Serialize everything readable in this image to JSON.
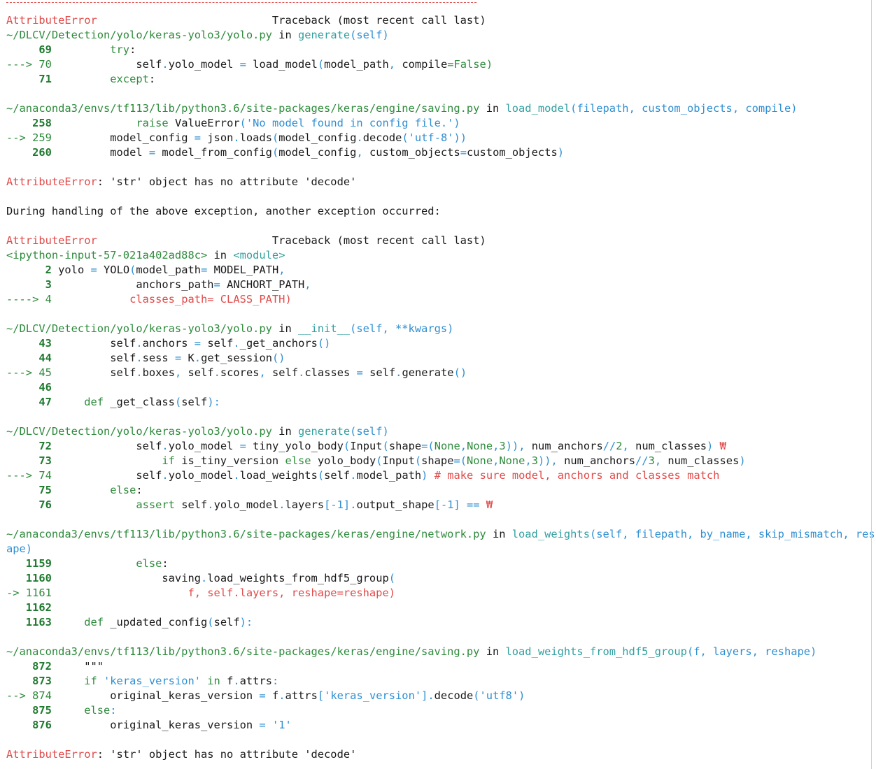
{
  "colors": {
    "red": "#e24a4a",
    "green": "#2e8b3c",
    "lineno_green": "#1e7a2e",
    "blue": "#2f8fd1",
    "teal": "#33a0a0",
    "text": "#1a1a1a",
    "background": "#ffffff"
  },
  "lines": [
    [],
    [
      {
        "t": "AttributeError",
        "c": "r"
      },
      {
        "t": "                           Traceback (most recent call last)",
        "c": "k"
      }
    ],
    [
      {
        "t": "~/DLCV/Detection/yolo/keras-yolo3/yolo.py",
        "c": "g"
      },
      {
        "t": " in ",
        "c": "k"
      },
      {
        "t": "generate",
        "c": "c"
      },
      {
        "t": "(self)",
        "c": "b"
      }
    ],
    [
      {
        "t": "     69",
        "c": "gb"
      },
      {
        "t": "         try",
        "c": "g"
      },
      {
        "t": ":",
        "c": "k"
      }
    ],
    [
      {
        "t": "---> 70",
        "c": "g"
      },
      {
        "t": "             self",
        "c": "k"
      },
      {
        "t": ".",
        "c": "b"
      },
      {
        "t": "yolo_model ",
        "c": "k"
      },
      {
        "t": "=",
        "c": "b"
      },
      {
        "t": " load_model",
        "c": "k"
      },
      {
        "t": "(",
        "c": "b"
      },
      {
        "t": "model_path",
        "c": "k"
      },
      {
        "t": ",",
        "c": "b"
      },
      {
        "t": " compile",
        "c": "k"
      },
      {
        "t": "=False)",
        "c": "g"
      }
    ],
    [
      {
        "t": "     71",
        "c": "gb"
      },
      {
        "t": "         except",
        "c": "g"
      },
      {
        "t": ":",
        "c": "k"
      }
    ],
    [],
    [
      {
        "t": "~/anaconda3/envs/tf113/lib/python3.6/site-packages/keras/engine/saving.py",
        "c": "g"
      },
      {
        "t": " in ",
        "c": "k"
      },
      {
        "t": "load_model",
        "c": "c"
      },
      {
        "t": "(filepath, custom_objects, compile)",
        "c": "b"
      }
    ],
    [
      {
        "t": "    258",
        "c": "gb"
      },
      {
        "t": "             raise",
        "c": "g"
      },
      {
        "t": " ValueError",
        "c": "k"
      },
      {
        "t": "('No model found in config file.')",
        "c": "b"
      }
    ],
    [
      {
        "t": "--> 259",
        "c": "g"
      },
      {
        "t": "         model_config ",
        "c": "k"
      },
      {
        "t": "=",
        "c": "b"
      },
      {
        "t": " json",
        "c": "k"
      },
      {
        "t": ".",
        "c": "b"
      },
      {
        "t": "loads",
        "c": "k"
      },
      {
        "t": "(",
        "c": "b"
      },
      {
        "t": "model_config",
        "c": "k"
      },
      {
        "t": ".",
        "c": "b"
      },
      {
        "t": "decode",
        "c": "k"
      },
      {
        "t": "('utf-8'))",
        "c": "b"
      }
    ],
    [
      {
        "t": "    260",
        "c": "gb"
      },
      {
        "t": "         model ",
        "c": "k"
      },
      {
        "t": "=",
        "c": "b"
      },
      {
        "t": " model_from_config",
        "c": "k"
      },
      {
        "t": "(",
        "c": "b"
      },
      {
        "t": "model_config",
        "c": "k"
      },
      {
        "t": ",",
        "c": "b"
      },
      {
        "t": " custom_objects",
        "c": "k"
      },
      {
        "t": "=",
        "c": "b"
      },
      {
        "t": "custom_objects",
        "c": "k"
      },
      {
        "t": ")",
        "c": "b"
      }
    ],
    [],
    [
      {
        "t": "AttributeError",
        "c": "r"
      },
      {
        "t": ": 'str' object has no attribute 'decode'",
        "c": "k"
      }
    ],
    [],
    [
      {
        "t": "During handling of the above exception, another exception occurred:",
        "c": "k"
      }
    ],
    [],
    [
      {
        "t": "AttributeError",
        "c": "r"
      },
      {
        "t": "                           Traceback (most recent call last)",
        "c": "k"
      }
    ],
    [
      {
        "t": "<ipython-input-57-021a402ad88c>",
        "c": "g"
      },
      {
        "t": " in ",
        "c": "k"
      },
      {
        "t": "<module>",
        "c": "c"
      }
    ],
    [
      {
        "t": "      2",
        "c": "gb"
      },
      {
        "t": " yolo ",
        "c": "k"
      },
      {
        "t": "=",
        "c": "b"
      },
      {
        "t": " YOLO",
        "c": "k"
      },
      {
        "t": "(",
        "c": "b"
      },
      {
        "t": "model_path",
        "c": "k"
      },
      {
        "t": "=",
        "c": "b"
      },
      {
        "t": " MODEL_PATH",
        "c": "k"
      },
      {
        "t": ",",
        "c": "b"
      }
    ],
    [
      {
        "t": "      3",
        "c": "gb"
      },
      {
        "t": "             anchors_path",
        "c": "k"
      },
      {
        "t": "=",
        "c": "b"
      },
      {
        "t": " ANCHORT_PATH",
        "c": "k"
      },
      {
        "t": ",",
        "c": "b"
      }
    ],
    [
      {
        "t": "----> 4",
        "c": "g"
      },
      {
        "t": "            classes_path= CLASS_PATH)",
        "c": "r"
      }
    ],
    [],
    [
      {
        "t": "~/DLCV/Detection/yolo/keras-yolo3/yolo.py",
        "c": "g"
      },
      {
        "t": " in ",
        "c": "k"
      },
      {
        "t": "__init__",
        "c": "c"
      },
      {
        "t": "(self, **kwargs)",
        "c": "b"
      }
    ],
    [
      {
        "t": "     43",
        "c": "gb"
      },
      {
        "t": "         self",
        "c": "k"
      },
      {
        "t": ".",
        "c": "b"
      },
      {
        "t": "anchors ",
        "c": "k"
      },
      {
        "t": "=",
        "c": "b"
      },
      {
        "t": " self",
        "c": "k"
      },
      {
        "t": ".",
        "c": "b"
      },
      {
        "t": "_get_anchors",
        "c": "k"
      },
      {
        "t": "()",
        "c": "b"
      }
    ],
    [
      {
        "t": "     44",
        "c": "gb"
      },
      {
        "t": "         self",
        "c": "k"
      },
      {
        "t": ".",
        "c": "b"
      },
      {
        "t": "sess ",
        "c": "k"
      },
      {
        "t": "=",
        "c": "b"
      },
      {
        "t": " K",
        "c": "k"
      },
      {
        "t": ".",
        "c": "b"
      },
      {
        "t": "get_session",
        "c": "k"
      },
      {
        "t": "()",
        "c": "b"
      }
    ],
    [
      {
        "t": "---> 45",
        "c": "g"
      },
      {
        "t": "         self",
        "c": "k"
      },
      {
        "t": ".",
        "c": "b"
      },
      {
        "t": "boxes",
        "c": "k"
      },
      {
        "t": ",",
        "c": "b"
      },
      {
        "t": " self",
        "c": "k"
      },
      {
        "t": ".",
        "c": "b"
      },
      {
        "t": "scores",
        "c": "k"
      },
      {
        "t": ",",
        "c": "b"
      },
      {
        "t": " self",
        "c": "k"
      },
      {
        "t": ".",
        "c": "b"
      },
      {
        "t": "classes ",
        "c": "k"
      },
      {
        "t": "=",
        "c": "b"
      },
      {
        "t": " self",
        "c": "k"
      },
      {
        "t": ".",
        "c": "b"
      },
      {
        "t": "generate",
        "c": "k"
      },
      {
        "t": "()",
        "c": "b"
      }
    ],
    [
      {
        "t": "     46",
        "c": "gb"
      }
    ],
    [
      {
        "t": "     47",
        "c": "gb"
      },
      {
        "t": "     def",
        "c": "g"
      },
      {
        "t": " _get_class",
        "c": "k"
      },
      {
        "t": "(",
        "c": "b"
      },
      {
        "t": "self",
        "c": "k"
      },
      {
        "t": "):",
        "c": "b"
      }
    ],
    [],
    [
      {
        "t": "~/DLCV/Detection/yolo/keras-yolo3/yolo.py",
        "c": "g"
      },
      {
        "t": " in ",
        "c": "k"
      },
      {
        "t": "generate",
        "c": "c"
      },
      {
        "t": "(self)",
        "c": "b"
      }
    ],
    [
      {
        "t": "     72",
        "c": "gb"
      },
      {
        "t": "             self",
        "c": "k"
      },
      {
        "t": ".",
        "c": "b"
      },
      {
        "t": "yolo_model ",
        "c": "k"
      },
      {
        "t": "=",
        "c": "b"
      },
      {
        "t": " tiny_yolo_body",
        "c": "k"
      },
      {
        "t": "(",
        "c": "b"
      },
      {
        "t": "Input",
        "c": "k"
      },
      {
        "t": "(",
        "c": "b"
      },
      {
        "t": "shape",
        "c": "k"
      },
      {
        "t": "=(",
        "c": "b"
      },
      {
        "t": "None",
        "c": "g"
      },
      {
        "t": ",",
        "c": "b"
      },
      {
        "t": "None",
        "c": "g"
      },
      {
        "t": ",",
        "c": "b"
      },
      {
        "t": "3",
        "c": "g"
      },
      {
        "t": ")),",
        "c": "b"
      },
      {
        "t": " num_anchors",
        "c": "k"
      },
      {
        "t": "//",
        "c": "b"
      },
      {
        "t": "2",
        "c": "g"
      },
      {
        "t": ",",
        "c": "b"
      },
      {
        "t": " num_classes",
        "c": "k"
      },
      {
        "t": ")",
        "c": "b"
      },
      {
        "t": " ₩",
        "c": "r"
      }
    ],
    [
      {
        "t": "     73",
        "c": "gb"
      },
      {
        "t": "                 if",
        "c": "g"
      },
      {
        "t": " is_tiny_version ",
        "c": "k"
      },
      {
        "t": "else",
        "c": "g"
      },
      {
        "t": " yolo_body",
        "c": "k"
      },
      {
        "t": "(",
        "c": "b"
      },
      {
        "t": "Input",
        "c": "k"
      },
      {
        "t": "(",
        "c": "b"
      },
      {
        "t": "shape",
        "c": "k"
      },
      {
        "t": "=(",
        "c": "b"
      },
      {
        "t": "None",
        "c": "g"
      },
      {
        "t": ",",
        "c": "b"
      },
      {
        "t": "None",
        "c": "g"
      },
      {
        "t": ",",
        "c": "b"
      },
      {
        "t": "3",
        "c": "g"
      },
      {
        "t": ")),",
        "c": "b"
      },
      {
        "t": " num_anchors",
        "c": "k"
      },
      {
        "t": "//",
        "c": "b"
      },
      {
        "t": "3",
        "c": "g"
      },
      {
        "t": ",",
        "c": "b"
      },
      {
        "t": " num_classes",
        "c": "k"
      },
      {
        "t": ")",
        "c": "b"
      }
    ],
    [
      {
        "t": "---> 74",
        "c": "g"
      },
      {
        "t": "             self",
        "c": "k"
      },
      {
        "t": ".",
        "c": "b"
      },
      {
        "t": "yolo_model",
        "c": "k"
      },
      {
        "t": ".",
        "c": "b"
      },
      {
        "t": "load_weights",
        "c": "k"
      },
      {
        "t": "(",
        "c": "b"
      },
      {
        "t": "self",
        "c": "k"
      },
      {
        "t": ".",
        "c": "b"
      },
      {
        "t": "model_path",
        "c": "k"
      },
      {
        "t": ")",
        "c": "b"
      },
      {
        "t": " # make sure model, anchors and classes match",
        "c": "r"
      }
    ],
    [
      {
        "t": "     75",
        "c": "gb"
      },
      {
        "t": "         else",
        "c": "g"
      },
      {
        "t": ":",
        "c": "k"
      }
    ],
    [
      {
        "t": "     76",
        "c": "gb"
      },
      {
        "t": "             assert",
        "c": "g"
      },
      {
        "t": " self",
        "c": "k"
      },
      {
        "t": ".",
        "c": "b"
      },
      {
        "t": "yolo_model",
        "c": "k"
      },
      {
        "t": ".",
        "c": "b"
      },
      {
        "t": "layers",
        "c": "k"
      },
      {
        "t": "[-1]",
        "c": "b"
      },
      {
        "t": ".",
        "c": "b"
      },
      {
        "t": "output_shape",
        "c": "k"
      },
      {
        "t": "[-1]",
        "c": "b"
      },
      {
        "t": " ==",
        "c": "b"
      },
      {
        "t": " ₩",
        "c": "r"
      }
    ],
    [],
    [
      {
        "t": "~/anaconda3/envs/tf113/lib/python3.6/site-packages/keras/engine/network.py",
        "c": "g"
      },
      {
        "t": " in ",
        "c": "k"
      },
      {
        "t": "load_weights",
        "c": "c"
      },
      {
        "t": "(self, filepath, by_name, skip_mismatch, resh",
        "c": "b"
      }
    ],
    [
      {
        "t": "ape)",
        "c": "b"
      }
    ],
    [
      {
        "t": "   1159",
        "c": "gb"
      },
      {
        "t": "             else",
        "c": "g"
      },
      {
        "t": ":",
        "c": "k"
      }
    ],
    [
      {
        "t": "   1160",
        "c": "gb"
      },
      {
        "t": "                 saving",
        "c": "k"
      },
      {
        "t": ".",
        "c": "b"
      },
      {
        "t": "load_weights_from_hdf5_group",
        "c": "k"
      },
      {
        "t": "(",
        "c": "b"
      }
    ],
    [
      {
        "t": "-> 1161",
        "c": "g"
      },
      {
        "t": "                     f, self.layers, reshape=reshape)",
        "c": "r"
      }
    ],
    [
      {
        "t": "   1162",
        "c": "gb"
      }
    ],
    [
      {
        "t": "   1163",
        "c": "gb"
      },
      {
        "t": "     def",
        "c": "g"
      },
      {
        "t": " _updated_config",
        "c": "k"
      },
      {
        "t": "(",
        "c": "b"
      },
      {
        "t": "self",
        "c": "k"
      },
      {
        "t": "):",
        "c": "b"
      }
    ],
    [],
    [
      {
        "t": "~/anaconda3/envs/tf113/lib/python3.6/site-packages/keras/engine/saving.py",
        "c": "g"
      },
      {
        "t": " in ",
        "c": "k"
      },
      {
        "t": "load_weights_from_hdf5_group",
        "c": "c"
      },
      {
        "t": "(f, layers, reshape)",
        "c": "b"
      }
    ],
    [
      {
        "t": "    872",
        "c": "gb"
      },
      {
        "t": "     \"\"\"",
        "c": "k"
      }
    ],
    [
      {
        "t": "    873",
        "c": "gb"
      },
      {
        "t": "     if",
        "c": "g"
      },
      {
        "t": " 'keras_version'",
        "c": "b"
      },
      {
        "t": " in",
        "c": "g"
      },
      {
        "t": " f",
        "c": "k"
      },
      {
        "t": ".",
        "c": "b"
      },
      {
        "t": "attrs",
        "c": "k"
      },
      {
        "t": ":",
        "c": "b"
      }
    ],
    [
      {
        "t": "--> 874",
        "c": "g"
      },
      {
        "t": "         original_keras_version ",
        "c": "k"
      },
      {
        "t": "=",
        "c": "b"
      },
      {
        "t": " f",
        "c": "k"
      },
      {
        "t": ".",
        "c": "b"
      },
      {
        "t": "attrs",
        "c": "k"
      },
      {
        "t": "['keras_version']",
        "c": "b"
      },
      {
        "t": ".",
        "c": "b"
      },
      {
        "t": "decode",
        "c": "k"
      },
      {
        "t": "('utf8')",
        "c": "b"
      }
    ],
    [
      {
        "t": "    875",
        "c": "gb"
      },
      {
        "t": "     else",
        "c": "g"
      },
      {
        "t": ":",
        "c": "b"
      }
    ],
    [
      {
        "t": "    876",
        "c": "gb"
      },
      {
        "t": "         original_keras_version ",
        "c": "k"
      },
      {
        "t": "=",
        "c": "b"
      },
      {
        "t": " '1'",
        "c": "b"
      }
    ],
    [],
    [
      {
        "t": "AttributeError",
        "c": "r"
      },
      {
        "t": ": 'str' object has no attribute 'decode'",
        "c": "k"
      }
    ]
  ]
}
